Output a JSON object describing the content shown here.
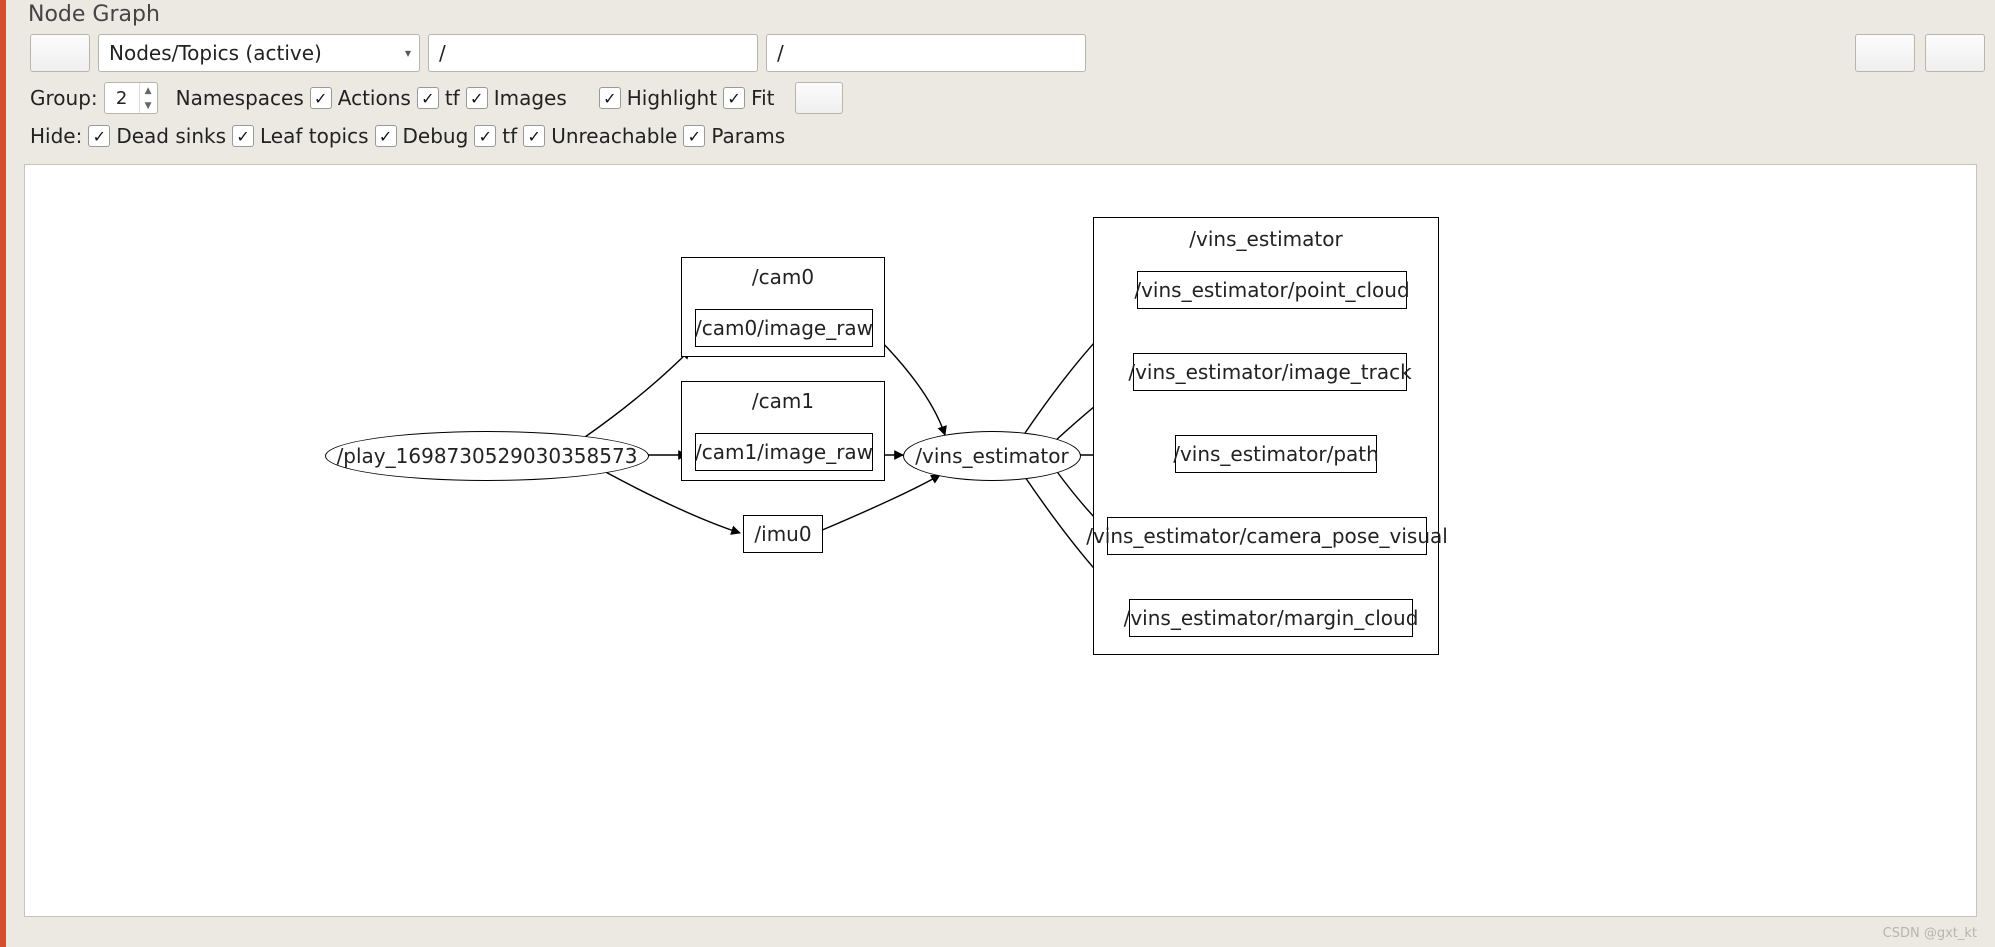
{
  "window": {
    "title": "Node Graph"
  },
  "toolbar1": {
    "view_mode": "Nodes/Topics (active)",
    "filter1_value": "/",
    "filter2_value": "/"
  },
  "toolbar2": {
    "group_label": "Group:",
    "group_value": "2",
    "namespaces": {
      "label": "Namespaces",
      "checked": true
    },
    "actions": {
      "label": "Actions",
      "checked": true
    },
    "tf": {
      "label": "tf",
      "checked": true
    },
    "images": {
      "label": "Images",
      "checked": true
    },
    "highlight": {
      "label": "Highlight",
      "checked": true
    },
    "fit": {
      "label": "Fit",
      "checked": true
    }
  },
  "toolbar3": {
    "hide_label": "Hide:",
    "dead_sinks": {
      "label": "Dead sinks",
      "checked": true
    },
    "leaf_topics": {
      "label": "Leaf topics",
      "checked": true
    },
    "debug": {
      "label": "Debug",
      "checked": true
    },
    "tf": {
      "label": "tf",
      "checked": true
    },
    "unreachable": {
      "label": "Unreachable",
      "checked": true
    },
    "params": {
      "label": "Params",
      "checked": true
    }
  },
  "graph": {
    "nodes": {
      "play": {
        "label": "/play_1698730529030358573"
      },
      "vins_estimator": {
        "label": "/vins_estimator"
      },
      "cam0": {
        "label": "/cam0"
      },
      "cam0_image_raw": {
        "label": "/cam0/image_raw"
      },
      "cam1": {
        "label": "/cam1"
      },
      "cam1_image_raw": {
        "label": "/cam1/image_raw"
      },
      "imu0": {
        "label": "/imu0"
      },
      "vins_cluster": {
        "label": "/vins_estimator"
      },
      "point_cloud": {
        "label": "/vins_estimator/point_cloud"
      },
      "image_track": {
        "label": "/vins_estimator/image_track"
      },
      "path": {
        "label": "/vins_estimator/path"
      },
      "camera_pose_vis": {
        "label": "/vins_estimator/camera_pose_visual"
      },
      "margin_cloud": {
        "label": "/vins_estimator/margin_cloud"
      }
    }
  },
  "watermark": "CSDN @gxt_kt"
}
